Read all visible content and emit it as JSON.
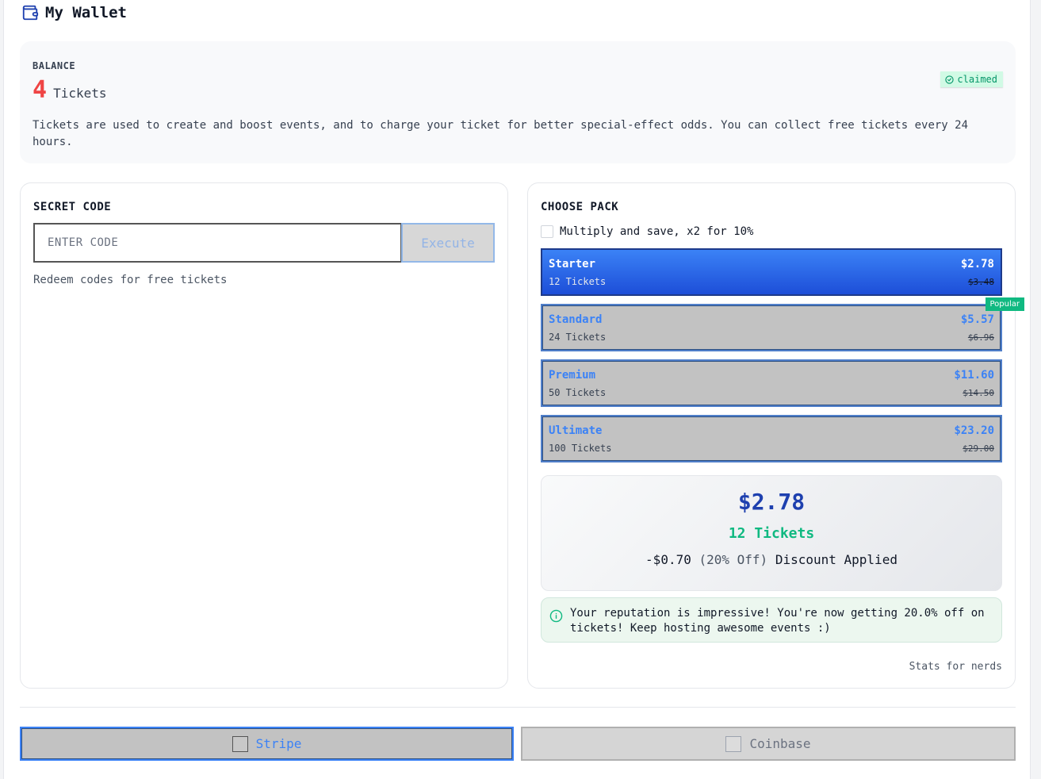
{
  "header": {
    "title": "My Wallet",
    "icon": "wallet-icon"
  },
  "balance": {
    "label": "BALANCE",
    "amount": "4",
    "unit": "Tickets",
    "badge": "claimed",
    "description": "Tickets are used to create and boost events, and to charge your ticket for better special-effect odds. You can collect free tickets every 24 hours."
  },
  "secret_code": {
    "title": "SECRET CODE",
    "placeholder": "ENTER CODE",
    "value": "",
    "execute_label": "Execute",
    "hint": "Redeem codes for free tickets"
  },
  "packs": {
    "title": "CHOOSE PACK",
    "multiply_label": "Multiply and save, x2 for 10%",
    "multiply_checked": false,
    "popular_label": "Popular",
    "items": [
      {
        "name": "Starter",
        "tickets": "12 Tickets",
        "price": "$2.78",
        "old_price": "$3.48",
        "selected": true
      },
      {
        "name": "Standard",
        "tickets": "24 Tickets",
        "price": "$5.57",
        "old_price": "$6.96",
        "selected": false
      },
      {
        "name": "Premium",
        "tickets": "50 Tickets",
        "price": "$11.60",
        "old_price": "$14.50",
        "selected": false
      },
      {
        "name": "Ultimate",
        "tickets": "100 Tickets",
        "price": "$23.20",
        "old_price": "$29.00",
        "selected": false
      }
    ]
  },
  "summary": {
    "price": "$2.78",
    "tickets": "12 Tickets",
    "discount_amount": "-$0.70",
    "discount_pct": "(20% Off)",
    "discount_text": "Discount Applied"
  },
  "info": {
    "text": "Your reputation is impressive! You're now getting 20.0% off on tickets! Keep hosting awesome events :)"
  },
  "stats_link": "Stats for nerds",
  "payment": {
    "stripe_label": "Stripe",
    "coinbase_label": "Coinbase"
  },
  "colors": {
    "accent": "#3b82f6",
    "balance": "#ef4444",
    "success": "#10b981",
    "price": "#1e40af"
  }
}
